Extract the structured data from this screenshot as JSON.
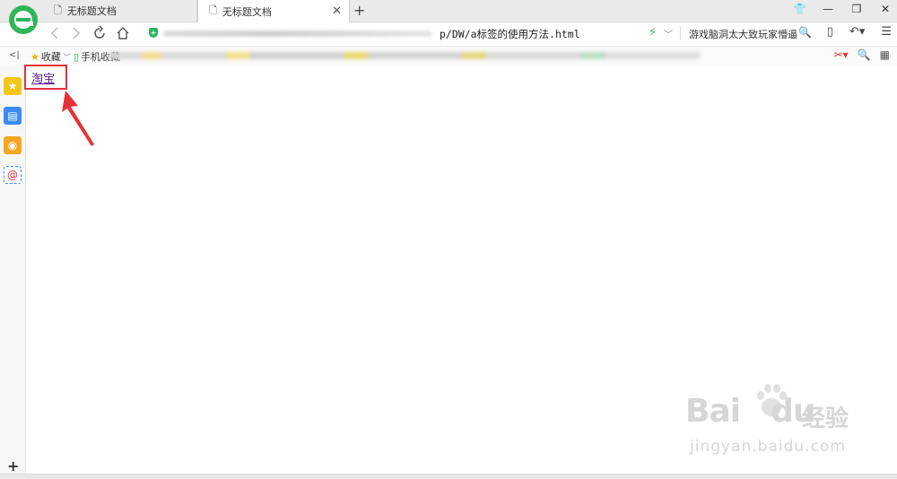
{
  "tabs": [
    {
      "title": "无标题文档",
      "active": false
    },
    {
      "title": "无标题文档",
      "active": true
    }
  ],
  "new_tab_symbol": "+",
  "window_controls": [
    "skin",
    "minimize",
    "restore",
    "close"
  ],
  "address": {
    "url_visible": "p/DW/a标签的使用方法.html",
    "security": "shield-icon"
  },
  "search": {
    "text": "游戏脑洞太大致玩家懵逼"
  },
  "bookmarks": {
    "collapse_symbol": "<|",
    "items": [
      {
        "label": "收藏",
        "icon": "star-icon"
      },
      {
        "label": "手机收藏",
        "icon": "phone-icon"
      }
    ]
  },
  "sidebar": {
    "items": [
      "favorites-icon",
      "reader-icon",
      "weibo-icon",
      "email-icon"
    ],
    "add_symbol": "+"
  },
  "page": {
    "link_text": "淘宝"
  },
  "watermark": {
    "brand": "Bai",
    "brand2": "du",
    "cn": "经验",
    "url": "jingyan.baidu.com"
  },
  "colors": {
    "highlight": "#e53238",
    "link": "#551a8b",
    "browser_green": "#2fb55b"
  }
}
